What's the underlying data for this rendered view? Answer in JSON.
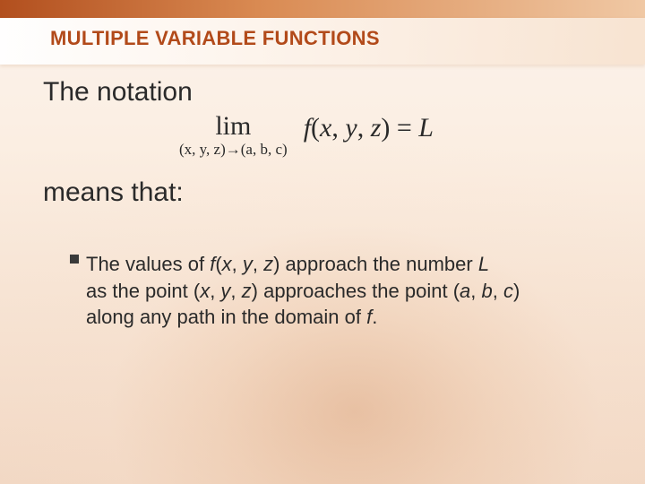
{
  "section_title": "MULTIPLE VARIABLE FUNCTIONS",
  "intro_line_1": "The notation",
  "formula": {
    "lim_word": "lim",
    "lim_sub_lhs": "(x, y, z)",
    "lim_sub_arrow": "→",
    "lim_sub_rhs": "(a, b, c)",
    "func_name": "f",
    "func_args_open": "(",
    "func_arg_x": "x",
    "func_comma1": ", ",
    "func_arg_y": "y",
    "func_comma2": ", ",
    "func_arg_z": "z",
    "func_args_close": ")",
    "equals": " = ",
    "rhs_value": "L"
  },
  "intro_line_2": "means that:",
  "bullet": {
    "seg1": "The values of ",
    "f": "f",
    "open1": "(",
    "x1": "x",
    "c1": ", ",
    "y1": "y",
    "c2": ", ",
    "z1": "z",
    "close1": ")",
    "seg2": " approach the number ",
    "L": "L",
    "seg3": " as the point (",
    "x2": "x",
    "c3": ", ",
    "y2": "y",
    "c4": ", ",
    "z2": "z",
    "close2": ")",
    "seg4": " approaches the point (",
    "a": "a",
    "c5": ", ",
    "b": "b",
    "c6": ", ",
    "cval": "c",
    "close3": ")",
    "seg5": " along any path in the domain of ",
    "f2": "f",
    "period": "."
  }
}
